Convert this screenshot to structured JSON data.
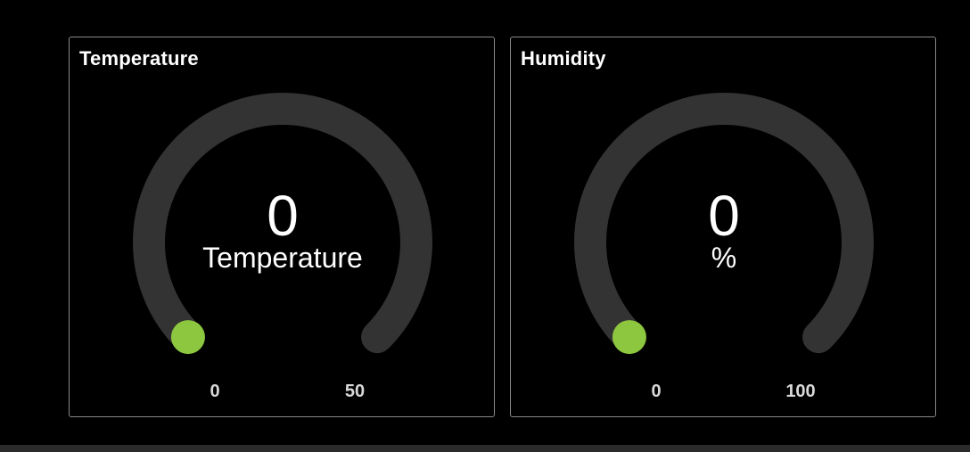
{
  "colors": {
    "background": "#000000",
    "track": "#333333",
    "indicator": "#8dc63f",
    "border": "#8a8a8a",
    "text": "#ffffff"
  },
  "gauges": [
    {
      "title": "Temperature",
      "value": "0",
      "unit": "Temperature",
      "min": "0",
      "max": "50"
    },
    {
      "title": "Humidity",
      "value": "0",
      "unit": "%",
      "min": "0",
      "max": "100"
    }
  ]
}
